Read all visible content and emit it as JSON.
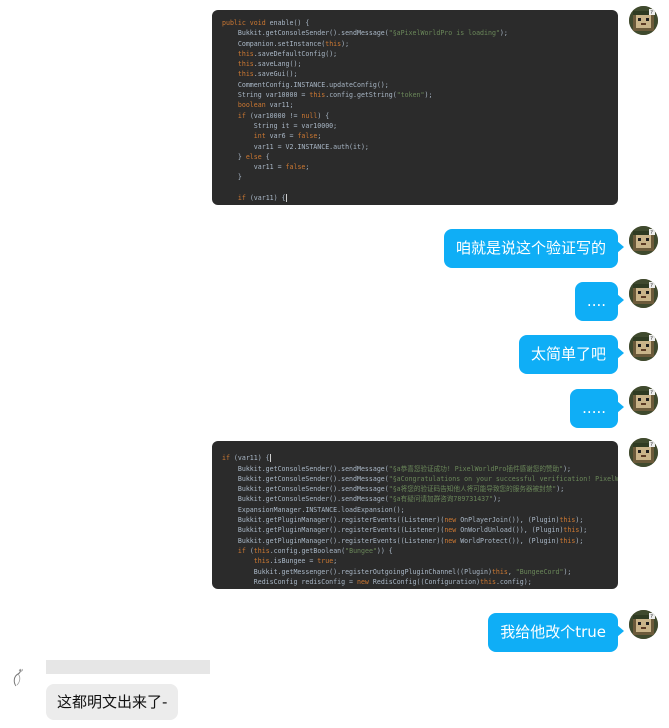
{
  "messages": {
    "code1": {
      "lines": [
        [
          {
            "t": "public void",
            "c": "kw"
          },
          {
            "t": " enable() {"
          }
        ],
        [
          {
            "t": "    Bukkit.getConsoleSender().sendMessage("
          },
          {
            "t": "\"§aPixelWorldPro is loading\"",
            "c": "str"
          },
          {
            "t": ");"
          }
        ],
        [
          {
            "t": "    Companion.setInstance("
          },
          {
            "t": "this",
            "c": "kw"
          },
          {
            "t": ");"
          }
        ],
        [
          {
            "t": "    "
          },
          {
            "t": "this",
            "c": "kw"
          },
          {
            "t": ".saveDefaultConfig();"
          }
        ],
        [
          {
            "t": "    "
          },
          {
            "t": "this",
            "c": "kw"
          },
          {
            "t": ".saveLang();"
          }
        ],
        [
          {
            "t": "    "
          },
          {
            "t": "this",
            "c": "kw"
          },
          {
            "t": ".saveGui();"
          }
        ],
        [
          {
            "t": "    CommentConfig.INSTANCE.updateConfig();"
          }
        ],
        [
          {
            "t": "    String var10000 = "
          },
          {
            "t": "this",
            "c": "kw"
          },
          {
            "t": ".config.getString("
          },
          {
            "t": "\"token\"",
            "c": "str"
          },
          {
            "t": ");"
          }
        ],
        [
          {
            "t": "    "
          },
          {
            "t": "boolean",
            "c": "kw"
          },
          {
            "t": " var11;"
          }
        ],
        [
          {
            "t": "    "
          },
          {
            "t": "if",
            "c": "kw"
          },
          {
            "t": " (var10000 != "
          },
          {
            "t": "null",
            "c": "kw"
          },
          {
            "t": ") {"
          }
        ],
        [
          {
            "t": "        String it = var10000;"
          }
        ],
        [
          {
            "t": "        "
          },
          {
            "t": "int",
            "c": "kw"
          },
          {
            "t": " var6 = "
          },
          {
            "t": "false",
            "c": "kw"
          },
          {
            "t": ";"
          }
        ],
        [
          {
            "t": "        var11 = V2.INSTANCE.auth(it);"
          }
        ],
        [
          {
            "t": "    } "
          },
          {
            "t": "else",
            "c": "kw"
          },
          {
            "t": " {"
          }
        ],
        [
          {
            "t": "        var11 = "
          },
          {
            "t": "false",
            "c": "kw"
          },
          {
            "t": ";"
          }
        ],
        [
          {
            "t": "    }"
          }
        ],
        [
          {
            "t": ""
          }
        ],
        [
          {
            "t": "    "
          },
          {
            "t": "if",
            "c": "kw"
          },
          {
            "t": " (var11) {",
            "caret": true
          }
        ]
      ]
    },
    "bubble1": "咱就是说这个验证写的",
    "bubble2": "....",
    "bubble3": "太简单了吧",
    "bubble4": ".....",
    "code2": {
      "lines": [
        [
          {
            "t": ""
          }
        ],
        [
          {
            "t": "if",
            "c": "kw"
          },
          {
            "t": " (var11) {",
            "caret": true
          }
        ],
        [
          {
            "t": "    Bukkit.getConsoleSender().sendMessage("
          },
          {
            "t": "\"§a恭喜您验证成功! PixelWorldPro插件感谢您的赞助\"",
            "c": "str"
          },
          {
            "t": ");"
          }
        ],
        [
          {
            "t": "    Bukkit.getConsoleSender().sendMessage("
          },
          {
            "t": "\"§aCongratulations on your successful verification! PixelWo",
            "c": "str"
          }
        ],
        [
          {
            "t": "    Bukkit.getConsoleSender().sendMessage("
          },
          {
            "t": "\"§a将您的验证码告知他人将可能导致您的服务器被封禁\"",
            "c": "str"
          },
          {
            "t": ");"
          }
        ],
        [
          {
            "t": "    Bukkit.getConsoleSender().sendMessage("
          },
          {
            "t": "\"§a有疑问请加群咨询789731437\"",
            "c": "str"
          },
          {
            "t": ");"
          }
        ],
        [
          {
            "t": "    ExpansionManager.INSTANCE.loadExpansion();"
          }
        ],
        [
          {
            "t": "    Bukkit.getPluginManager().registerEvents((Listener)("
          },
          {
            "t": "new",
            "c": "kw"
          },
          {
            "t": " OnPlayerJoin()), (Plugin)"
          },
          {
            "t": "this",
            "c": "kw"
          },
          {
            "t": ");"
          }
        ],
        [
          {
            "t": "    Bukkit.getPluginManager().registerEvents((Listener)("
          },
          {
            "t": "new",
            "c": "kw"
          },
          {
            "t": " OnWorldUnload()), (Plugin)"
          },
          {
            "t": "this",
            "c": "kw"
          },
          {
            "t": ");"
          }
        ],
        [
          {
            "t": "    Bukkit.getPluginManager().registerEvents((Listener)("
          },
          {
            "t": "new",
            "c": "kw"
          },
          {
            "t": " WorldProtect()), (Plugin)"
          },
          {
            "t": "this",
            "c": "kw"
          },
          {
            "t": ");"
          }
        ],
        [
          {
            "t": "    "
          },
          {
            "t": "if",
            "c": "kw"
          },
          {
            "t": " ("
          },
          {
            "t": "this",
            "c": "kw"
          },
          {
            "t": ".config.getBoolean("
          },
          {
            "t": "\"Bungee\"",
            "c": "str"
          },
          {
            "t": ")) {"
          }
        ],
        [
          {
            "t": "        "
          },
          {
            "t": "this",
            "c": "kw"
          },
          {
            "t": ".isBungee = "
          },
          {
            "t": "true",
            "c": "kw"
          },
          {
            "t": ";"
          }
        ],
        [
          {
            "t": "        Bukkit.getMessenger().registerOutgoingPluginChannel((Plugin)"
          },
          {
            "t": "this",
            "c": "kw"
          },
          {
            "t": ", "
          },
          {
            "t": "\"BungeeCord\"",
            "c": "str"
          },
          {
            "t": ");"
          }
        ],
        [
          {
            "t": "        RedisConfig redisConfig = "
          },
          {
            "t": "new",
            "c": "kw"
          },
          {
            "t": " RedisConfig((Configuration)"
          },
          {
            "t": "this",
            "c": "kw"
          },
          {
            "t": ".config);"
          }
        ]
      ]
    },
    "bubble5": "我给他改个true",
    "left_bubble": "这都明文出来了-"
  },
  "colors": {
    "bubble_blue": "#0faef6",
    "code_bg": "#2b2b2b",
    "keyword": "#cc7832",
    "string": "#6a8759",
    "left_bubble_bg": "#ececec"
  },
  "icons": {
    "self_avatar": "avatar-icon",
    "other_avatar": "sketch-avatar-icon"
  }
}
